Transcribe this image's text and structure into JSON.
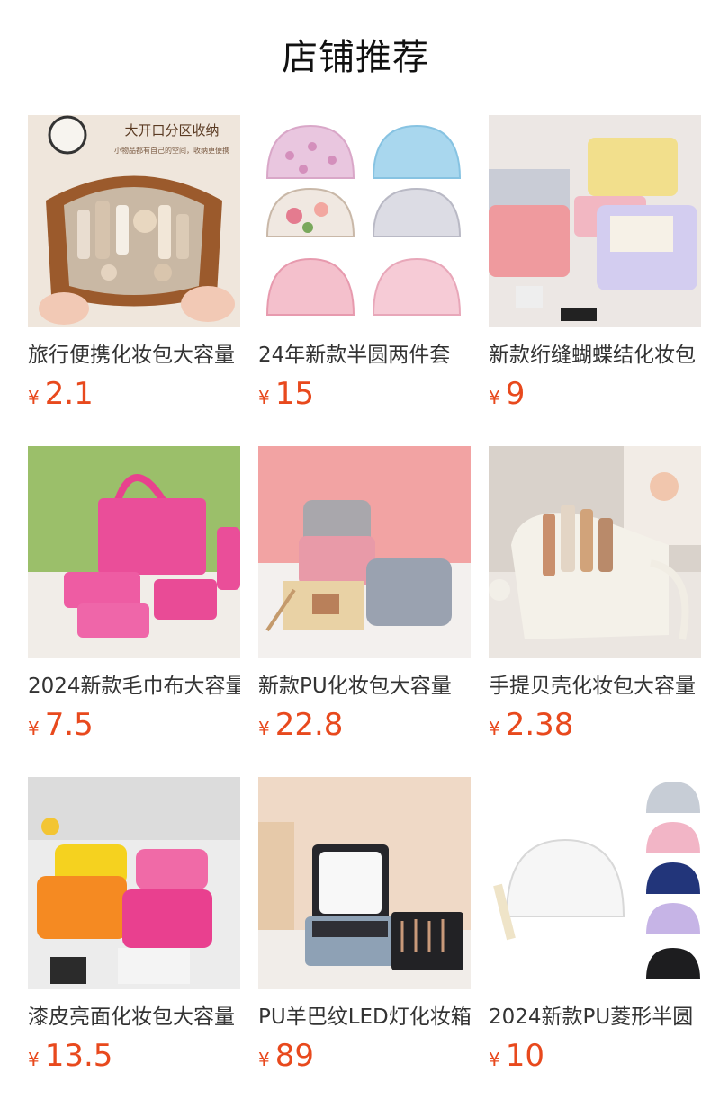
{
  "section": {
    "title": "店铺推荐"
  },
  "colors": {
    "price": "#e8491d",
    "title": "#111111",
    "product_name": "#333333"
  },
  "products": [
    {
      "name": "旅行便携化妆包大容量",
      "currency": "¥",
      "price": "2.1",
      "image": "brown-leather-cosmetic-bag",
      "image_text": [
        "大开口分区收纳",
        "小物品都有自己的空间，收纳更便携"
      ]
    },
    {
      "name": "24年新款半圆两件套",
      "currency": "¥",
      "price": "15",
      "image": "transparent-half-round-pouches"
    },
    {
      "name": "新款绗缝蝴蝶结化妆包",
      "currency": "¥",
      "price": "9",
      "image": "gingham-quilted-bags"
    },
    {
      "name": "2024新款毛巾布大容量",
      "currency": "¥",
      "price": "7.5",
      "image": "pink-towel-tote-set"
    },
    {
      "name": "新款PU化妆包大容量",
      "currency": "¥",
      "price": "22.8",
      "image": "pink-grey-pu-cases"
    },
    {
      "name": "手提贝壳化妆包大容量",
      "currency": "¥",
      "price": "2.38",
      "image": "white-shell-bag"
    },
    {
      "name": "漆皮亮面化妆包大容量",
      "currency": "¥",
      "price": "13.5",
      "image": "patent-leather-bags"
    },
    {
      "name": "PU羊巴纹LED灯化妆箱",
      "currency": "¥",
      "price": "89",
      "image": "led-mirror-case"
    },
    {
      "name": "2024新款PU菱形半圆",
      "currency": "¥",
      "price": "10",
      "image": "quilted-half-round-pouches"
    }
  ]
}
